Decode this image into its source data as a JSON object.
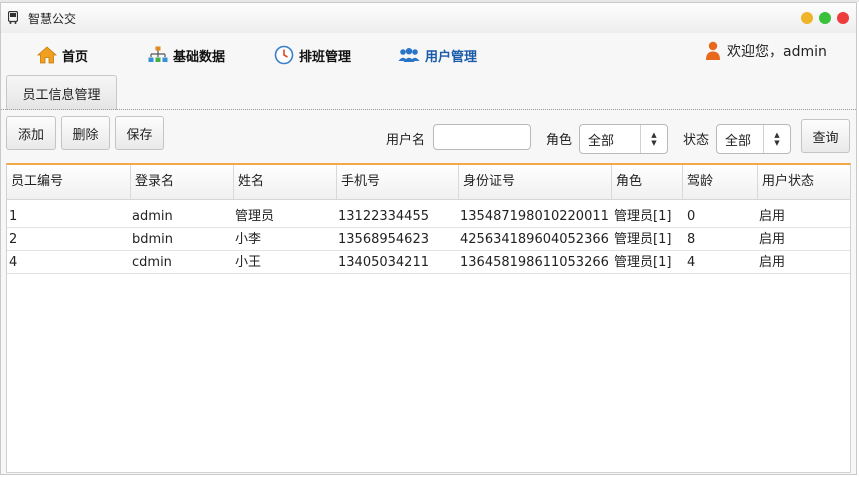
{
  "window": {
    "title": "智慧公交"
  },
  "nav": {
    "home": "首页",
    "basic_data": "基础数据",
    "shift_management": "排班管理",
    "user_management": "用户管理"
  },
  "user": {
    "welcome": "欢迎您，admin"
  },
  "tab": {
    "label": "员工信息管理"
  },
  "toolbar": {
    "add": "添加",
    "delete": "删除",
    "save": "保存",
    "username_label": "用户名",
    "username_value": "",
    "role_label": "角色",
    "role_value": "全部",
    "status_label": "状态",
    "status_value": "全部",
    "query": "查询"
  },
  "table": {
    "columns": [
      "员工编号",
      "登录名",
      "姓名",
      "手机号",
      "身份证号",
      "角色",
      "驾龄",
      "用户状态"
    ],
    "rows": [
      [
        "1",
        "admin",
        "管理员",
        "13122334455",
        "135487198010220011",
        "管理员[1]",
        "0",
        "启用"
      ],
      [
        "2",
        "bdmin",
        "小李",
        "13568954623",
        "425634189604052366",
        "管理员[1]",
        "8",
        "启用"
      ],
      [
        "4",
        "cdmin",
        "小王",
        "13405034211",
        "136458198611053266",
        "管理员[1]",
        "4",
        "启用"
      ]
    ]
  }
}
